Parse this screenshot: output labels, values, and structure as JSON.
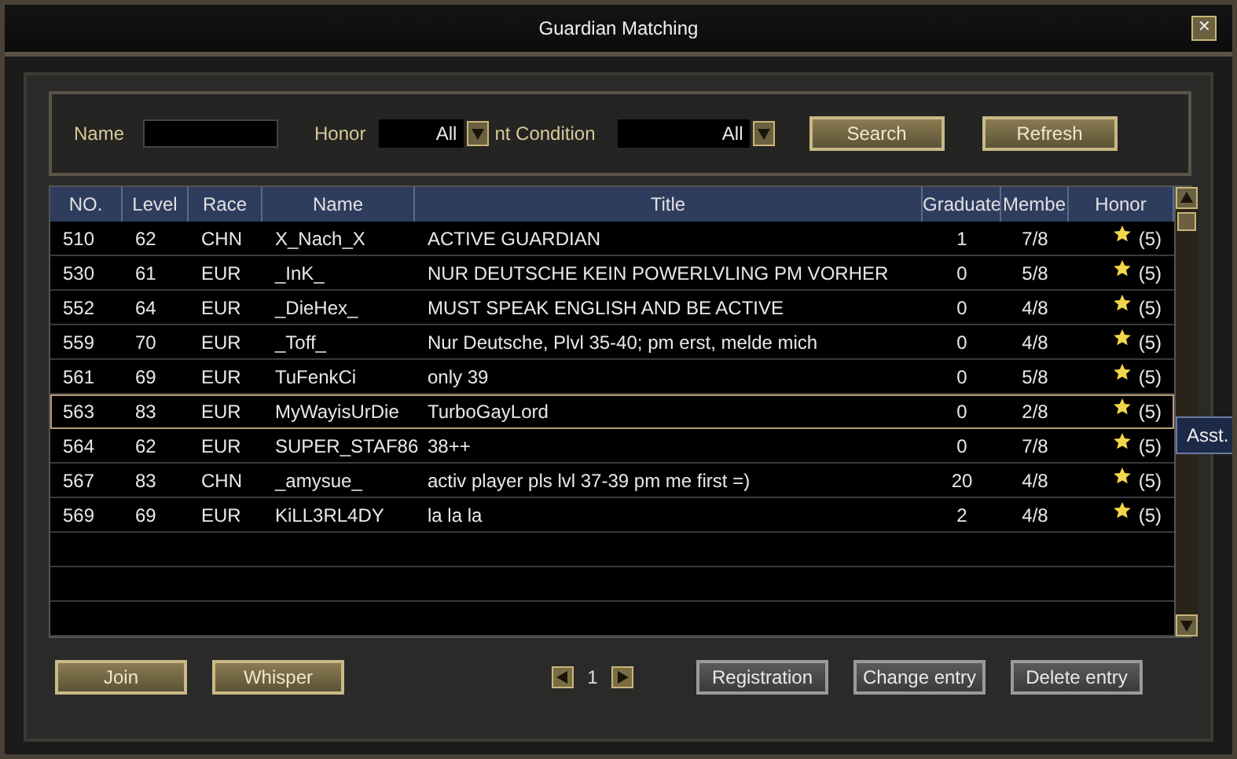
{
  "window": {
    "title": "Guardian Matching",
    "close": "✕"
  },
  "filters": {
    "name_label": "Name",
    "honor_label": "Honor",
    "honor_value": "All",
    "condition_label": "nt Condition",
    "condition_value": "All",
    "search": "Search",
    "refresh": "Refresh"
  },
  "table": {
    "columns": [
      "NO.",
      "Level",
      "Race",
      "Name",
      "Title",
      "Graduate",
      "Membe",
      "Honor"
    ],
    "rows": [
      {
        "no": "510",
        "level": "62",
        "race": "CHN",
        "name": "X_Nach_X",
        "title": "ACTIVE GUARDIAN",
        "graduate": "1",
        "members": "7/8",
        "honor": "(5)",
        "selected": false
      },
      {
        "no": "530",
        "level": "61",
        "race": "EUR",
        "name": "_InK_",
        "title": "NUR DEUTSCHE KEIN POWERLVLING PM VORHER",
        "graduate": "0",
        "members": "5/8",
        "honor": "(5)",
        "selected": false
      },
      {
        "no": "552",
        "level": "64",
        "race": "EUR",
        "name": "_DieHex_",
        "title": "MUST SPEAK ENGLISH AND BE ACTIVE",
        "graduate": "0",
        "members": "4/8",
        "honor": "(5)",
        "selected": false
      },
      {
        "no": "559",
        "level": "70",
        "race": "EUR",
        "name": "_Toff_",
        "title": "Nur Deutsche, Plvl 35-40; pm erst, melde mich",
        "graduate": "0",
        "members": "4/8",
        "honor": "(5)",
        "selected": false
      },
      {
        "no": "561",
        "level": "69",
        "race": "EUR",
        "name": "TuFenkCi",
        "title": "only 39",
        "graduate": "0",
        "members": "5/8",
        "honor": "(5)",
        "selected": false
      },
      {
        "no": "563",
        "level": "83",
        "race": "EUR",
        "name": "MyWayisUrDie",
        "title": "TurboGayLord",
        "graduate": "0",
        "members": "2/8",
        "honor": "(5)",
        "selected": true
      },
      {
        "no": "564",
        "level": "62",
        "race": "EUR",
        "name": "SUPER_STAF86",
        "title": "38++",
        "graduate": "0",
        "members": "7/8",
        "honor": "(5)",
        "selected": false
      },
      {
        "no": "567",
        "level": "83",
        "race": "CHN",
        "name": "_amysue_",
        "title": "activ player pls lvl 37-39 pm me first =)",
        "graduate": "20",
        "members": "4/8",
        "honor": "(5)",
        "selected": false
      },
      {
        "no": "569",
        "level": "69",
        "race": "EUR",
        "name": "KiLL3RL4DY",
        "title": "la la la",
        "graduate": "2",
        "members": "4/8",
        "honor": "(5)",
        "selected": false
      }
    ]
  },
  "tooltip": "Asst.",
  "footer": {
    "join": "Join",
    "whisper": "Whisper",
    "page": "1",
    "registration": "Registration",
    "change": "Change entry",
    "delete": "Delete entry"
  }
}
